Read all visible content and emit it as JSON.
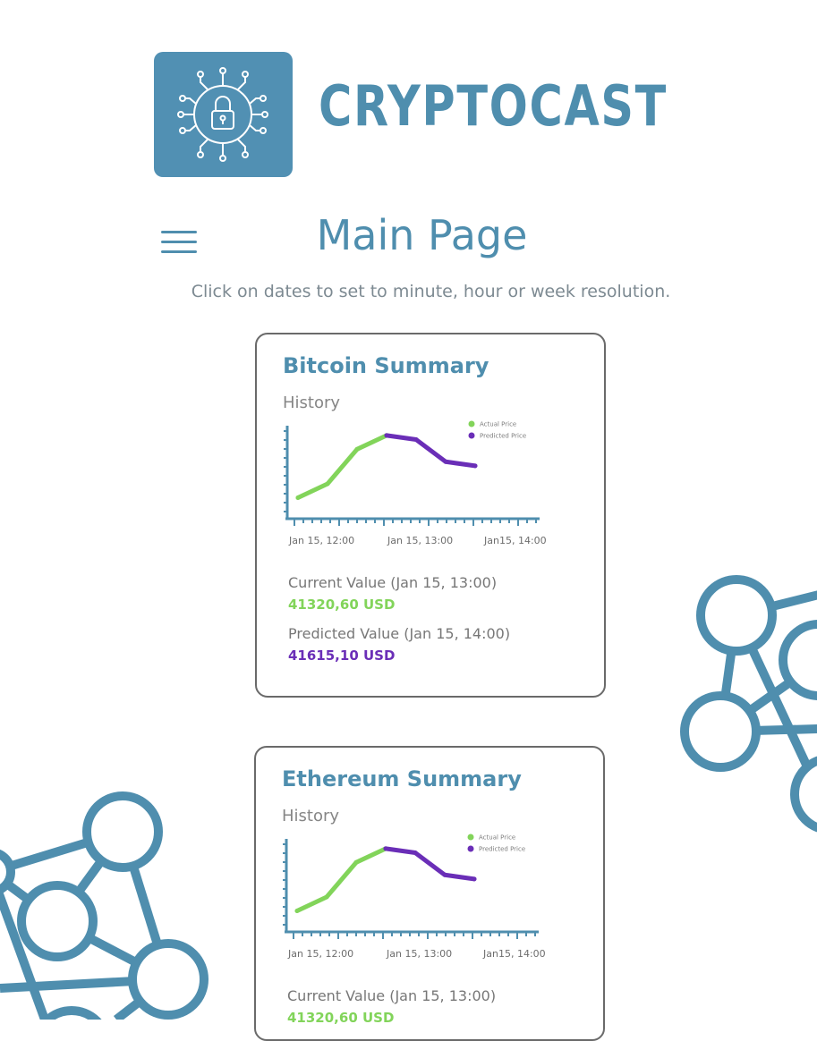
{
  "logo": {
    "text": "CRYPTOCAST"
  },
  "header": {
    "title": "Main Page",
    "instructions": "Click on dates to set to minute, hour or week resolution."
  },
  "colors": {
    "brand": "#4f8eae",
    "actual": "#82d45a",
    "predicted": "#6a2eb7"
  },
  "cards": [
    {
      "title": "Bitcoin Summary",
      "history_label": "History",
      "current_label": "Current Value (Jan 15, 13:00)",
      "current_value": "41320,60 USD",
      "predicted_label": "Predicted Value (Jan 15, 14:00)",
      "predicted_value": "41615,10 USD",
      "chart_data": {
        "type": "line",
        "x_tick_labels": [
          "Jan 15, 12:00",
          "Jan 15, 13:00",
          "Jan15, 14:00"
        ],
        "legend": [
          "Actual Price",
          "Predicted Price"
        ],
        "legend_position": "top-right",
        "series": [
          {
            "name": "Actual Price",
            "color": "#82d45a",
            "values": [
              1,
              2,
              4.5,
              5.5
            ]
          },
          {
            "name": "Predicted Price",
            "color": "#6a2eb7",
            "values": [
              5.5,
              5.2,
              3.6,
              3.3
            ]
          }
        ]
      }
    },
    {
      "title": "Ethereum Summary",
      "history_label": "History",
      "current_label": "Current Value (Jan 15, 13:00)",
      "current_value": "41320,60 USD",
      "chart_data": {
        "type": "line",
        "x_tick_labels": [
          "Jan 15, 12:00",
          "Jan 15, 13:00",
          "Jan15, 14:00"
        ],
        "legend": [
          "Actual Price",
          "Predicted Price"
        ],
        "legend_position": "top-right",
        "series": [
          {
            "name": "Actual Price",
            "color": "#82d45a",
            "values": [
              1,
              2,
              4.5,
              5.5
            ]
          },
          {
            "name": "Predicted Price",
            "color": "#6a2eb7",
            "values": [
              5.5,
              5.2,
              3.6,
              3.3
            ]
          }
        ]
      }
    }
  ]
}
